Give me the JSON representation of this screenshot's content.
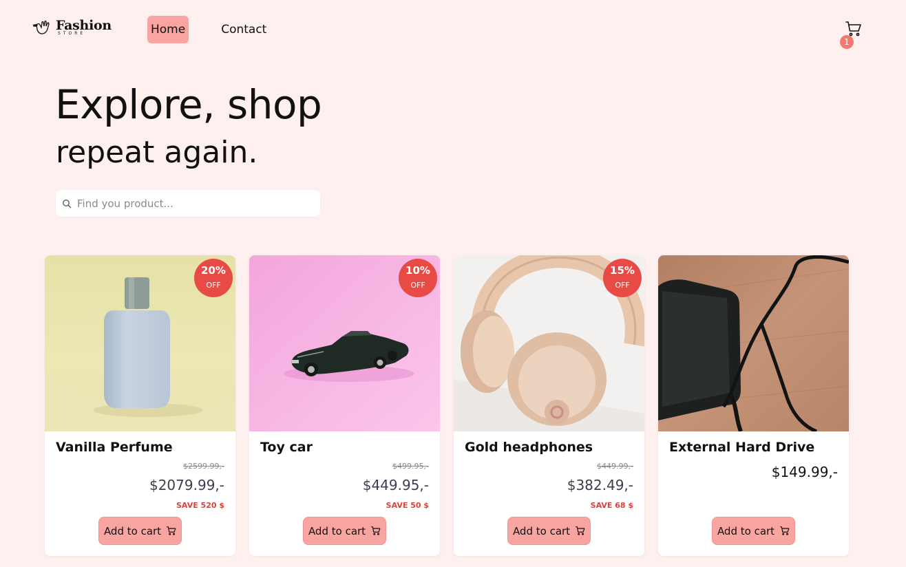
{
  "header": {
    "logo_title": "Fashion",
    "logo_subtitle": "STORE",
    "nav": [
      {
        "label": "Home",
        "active": true
      },
      {
        "label": "Contact",
        "active": false
      }
    ],
    "cart_count": "1"
  },
  "hero": {
    "line1": "Explore, shop",
    "line2": "repeat again."
  },
  "search": {
    "placeholder": "Find you product..."
  },
  "products": [
    {
      "title": "Vanilla Perfume",
      "discount_pct": "20%",
      "discount_off": "OFF",
      "old_price": "$2599.99,-",
      "price": "$2079.99,-",
      "save": "SAVE 520 $",
      "button": "Add to cart"
    },
    {
      "title": "Toy car",
      "discount_pct": "10%",
      "discount_off": "OFF",
      "old_price": "$499.95,-",
      "price": "$449.95,-",
      "save": "SAVE 50 $",
      "button": "Add to cart"
    },
    {
      "title": "Gold headphones",
      "discount_pct": "15%",
      "discount_off": "OFF",
      "old_price": "$449.99,-",
      "price": "$382.49,-",
      "save": "SAVE 68 $",
      "button": "Add to cart"
    },
    {
      "title": "External Hard Drive",
      "price": "$149.99,-",
      "button": "Add to cart"
    }
  ],
  "colors": {
    "background": "#fff0f0",
    "accent": "#f8a4a0",
    "badge": "#e84a46",
    "save_text": "#e0403a"
  },
  "icons": [
    "hand-logo-icon",
    "cart-icon",
    "search-icon",
    "cart-small-icon"
  ]
}
